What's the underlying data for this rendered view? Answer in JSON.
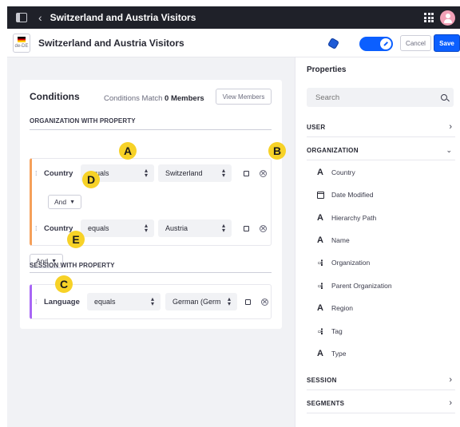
{
  "topbar": {
    "back": "‹",
    "title": "Switzerland and Austria Visitors",
    "icons": [
      "sidebar-toggle-icon",
      "apps-grid-icon",
      "user-avatar-icon"
    ]
  },
  "subbar": {
    "locale": "de-DE",
    "title": "Switzerland and Austria Visitors",
    "cancel_label": "Cancel",
    "save_label": "Save"
  },
  "conditions": {
    "title": "Conditions",
    "match_label": "Conditions Match",
    "match_count": "0 Members",
    "view_members_label": "View Members",
    "org_section_label": "ORGANIZATION WITH PROPERTY",
    "session_section_label": "SESSION WITH PROPERTY",
    "org_rows": [
      {
        "property": "Country",
        "operator": "equals",
        "value": "Switzerland"
      },
      {
        "property": "Country",
        "operator": "equals",
        "value": "Austria"
      }
    ],
    "inner_conjunction": "And",
    "outer_conjunction": "And",
    "session_row": {
      "property": "Language",
      "operator": "equals",
      "value": "German (Germ"
    }
  },
  "callouts": {
    "a": "A",
    "b": "B",
    "c": "C",
    "d": "D",
    "e": "E"
  },
  "properties": {
    "title": "Properties",
    "search_placeholder": "Search",
    "categories": {
      "user": "USER",
      "organization": "ORGANIZATION",
      "session": "SESSION",
      "segments": "SEGMENTS"
    },
    "org_items": [
      {
        "type": "A",
        "name": "Country"
      },
      {
        "type": "date",
        "name": "Date Modified"
      },
      {
        "type": "A",
        "name": "Hierarchy Path"
      },
      {
        "type": "A",
        "name": "Name"
      },
      {
        "type": "ref",
        "name": "Organization"
      },
      {
        "type": "ref",
        "name": "Parent Organization"
      },
      {
        "type": "A",
        "name": "Region"
      },
      {
        "type": "ref",
        "name": "Tag"
      },
      {
        "type": "A",
        "name": "Type"
      }
    ]
  },
  "colors": {
    "topbar": "#1f2129",
    "primary": "#0b5fff",
    "org_accent": "#f5a05a",
    "session_accent": "#a866f5",
    "callout": "#f7d227"
  }
}
